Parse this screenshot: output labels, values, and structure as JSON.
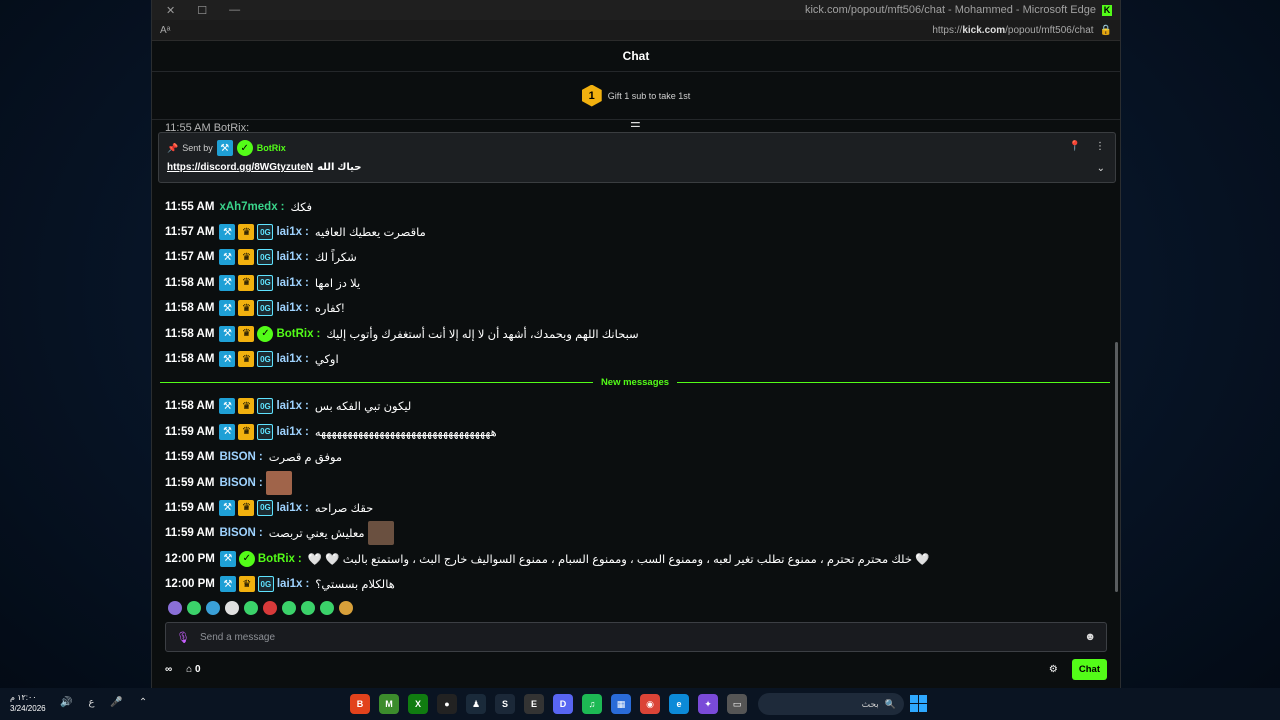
{
  "window": {
    "title": "kick.com/popout/mft506/chat - Mohammed - Microsoft Edge",
    "url_prefix": "https://",
    "url_host": "kick.com",
    "url_path": "/popout/mft506/chat",
    "read_aloud": "Aᵃ"
  },
  "chat": {
    "header": "Chat",
    "gift_count": "1",
    "gift_text": "Gift 1 sub to take 1st",
    "peek_text": "11:55 AM BotRix:",
    "pinned": {
      "sent_by": "Sent by",
      "sender": "BotRix",
      "link": "https://discord.gg/8WGtyzuteN",
      "text": "حياك الله"
    },
    "new_messages_label": "New messages",
    "messages_before": [
      {
        "time": "11:55 AM",
        "user": "xAh7medx",
        "color": "#3ad38a",
        "badges": [],
        "text": "فكك"
      },
      {
        "time": "11:57 AM",
        "user": "lai1x",
        "color": "#9fd3ff",
        "badges": [
          "mod",
          "crown",
          "sub"
        ],
        "text": "ماقصرت يعطيك العافيه"
      },
      {
        "time": "11:57 AM",
        "user": "lai1x",
        "color": "#9fd3ff",
        "badges": [
          "mod",
          "crown",
          "sub"
        ],
        "text": "شكراً لك"
      },
      {
        "time": "11:58 AM",
        "user": "lai1x",
        "color": "#9fd3ff",
        "badges": [
          "mod",
          "crown",
          "sub"
        ],
        "text": "يلا دز امها"
      },
      {
        "time": "11:58 AM",
        "user": "lai1x",
        "color": "#9fd3ff",
        "badges": [
          "mod",
          "crown",
          "sub"
        ],
        "text": "كفاره!"
      },
      {
        "time": "11:58 AM",
        "user": "BotRix",
        "color": "#53fc18",
        "badges": [
          "mod",
          "crown",
          "verify"
        ],
        "text": "سبحانك اللهم وبحمدك، أشهد أن لا إله إلا أنت أستغفرك وأتوب إليك"
      },
      {
        "time": "11:58 AM",
        "user": "lai1x",
        "color": "#9fd3ff",
        "badges": [
          "mod",
          "crown",
          "sub"
        ],
        "text": "اوكي"
      }
    ],
    "messages_after": [
      {
        "time": "11:58 AM",
        "user": "lai1x",
        "color": "#9fd3ff",
        "badges": [
          "mod",
          "crown",
          "sub"
        ],
        "text": "ليكون تبي الفكه بس"
      },
      {
        "time": "11:59 AM",
        "user": "lai1x",
        "color": "#9fd3ff",
        "badges": [
          "mod",
          "crown",
          "sub"
        ],
        "text": "هههههههههههههههههههههههههههههههههه"
      },
      {
        "time": "11:59 AM",
        "user": "BISON",
        "color": "#9fd3ff",
        "badges": [],
        "text": "موفق م قصرت"
      },
      {
        "time": "11:59 AM",
        "user": "BISON",
        "color": "#9fd3ff",
        "badges": [],
        "text": "",
        "thumb": "#a0644a"
      },
      {
        "time": "11:59 AM",
        "user": "lai1x",
        "color": "#9fd3ff",
        "badges": [
          "mod",
          "crown",
          "sub"
        ],
        "text": "حقك صراحه"
      },
      {
        "time": "11:59 AM",
        "user": "BISON",
        "color": "#9fd3ff",
        "badges": [],
        "text": "معليش يعني تربصت",
        "thumb": "#6a5040"
      },
      {
        "time": "12:00 PM",
        "user": "BotRix",
        "color": "#53fc18",
        "badges": [
          "mod",
          "verify"
        ],
        "text": "🤍 🤍 خلك محترم تحترم ، ممنوع تطلب تغير لعبه ، وممنوع السب ، وممنوع السبام ، ممنوع السواليف خارج البث ، واستمتع بالبث 🤍"
      },
      {
        "time": "12:00 PM",
        "user": "lai1x",
        "color": "#9fd3ff",
        "badges": [
          "mod",
          "crown",
          "sub"
        ],
        "text": "هالكلام بسستي؟"
      }
    ],
    "emote_colors": [
      "#8a6fd8",
      "#3bd26a",
      "#3aa0d8",
      "#e0e0e0",
      "#3bd26a",
      "#d83a3a",
      "#3bd26a",
      "#3bd26a",
      "#3bd26a",
      "#d8a03a"
    ],
    "input_placeholder": "Send a message",
    "infinity_icon": "∞",
    "points": "0",
    "send_label": "Chat"
  },
  "badge_glyphs": {
    "mod": "⚒",
    "crown": "♛",
    "sub": "0G",
    "verify": "✓"
  },
  "taskbar": {
    "time": "١٢:٠٠ م",
    "date": "3/24/2026",
    "lang": "ع",
    "search_placeholder": "بحث"
  }
}
